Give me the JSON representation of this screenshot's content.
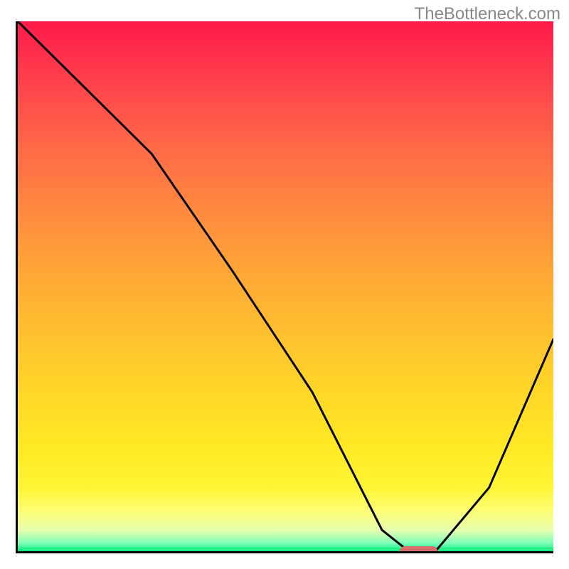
{
  "watermark": "TheBottleneck.com",
  "chart_data": {
    "type": "line",
    "title": "",
    "xlabel": "",
    "ylabel": "",
    "xlim": [
      0,
      100
    ],
    "ylim": [
      0,
      100
    ],
    "grid": false,
    "curve": {
      "x": [
        0,
        14,
        25,
        40,
        55,
        63,
        68,
        73,
        78,
        88,
        100
      ],
      "values": [
        100,
        86,
        75,
        53,
        30,
        14,
        4,
        0,
        0,
        12,
        40
      ]
    },
    "marker": {
      "x_start": 71,
      "x_end": 78,
      "y": 0,
      "color": "#d96b6b"
    },
    "gradient_stops": [
      {
        "pos": 0,
        "color": "#ff1a4a"
      },
      {
        "pos": 0.25,
        "color": "#ff6a47"
      },
      {
        "pos": 0.5,
        "color": "#ffa836"
      },
      {
        "pos": 0.75,
        "color": "#ffe824"
      },
      {
        "pos": 0.95,
        "color": "#fcff7e"
      },
      {
        "pos": 1.0,
        "color": "#00e878"
      }
    ]
  }
}
